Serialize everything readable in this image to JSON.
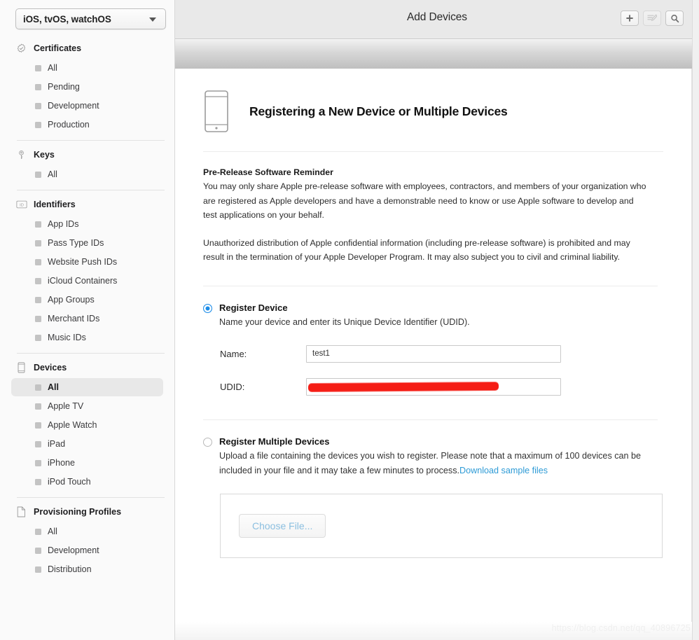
{
  "sidebar": {
    "platform_select": {
      "value": "iOS, tvOS, watchOS",
      "caret_icon": "chevron-down-icon"
    },
    "sections": [
      {
        "title": "Certificates",
        "icon": "certificate-seal-icon",
        "items": [
          {
            "label": "All",
            "selected": false
          },
          {
            "label": "Pending",
            "selected": false
          },
          {
            "label": "Development",
            "selected": false
          },
          {
            "label": "Production",
            "selected": false
          }
        ]
      },
      {
        "title": "Keys",
        "icon": "key-icon",
        "items": [
          {
            "label": "All",
            "selected": false
          }
        ]
      },
      {
        "title": "Identifiers",
        "icon": "id-badge-icon",
        "items": [
          {
            "label": "App IDs",
            "selected": false
          },
          {
            "label": "Pass Type IDs",
            "selected": false
          },
          {
            "label": "Website Push IDs",
            "selected": false
          },
          {
            "label": "iCloud Containers",
            "selected": false
          },
          {
            "label": "App Groups",
            "selected": false
          },
          {
            "label": "Merchant IDs",
            "selected": false
          },
          {
            "label": "Music IDs",
            "selected": false
          }
        ]
      },
      {
        "title": "Devices",
        "icon": "device-phone-icon",
        "items": [
          {
            "label": "All",
            "selected": true
          },
          {
            "label": "Apple TV",
            "selected": false
          },
          {
            "label": "Apple Watch",
            "selected": false
          },
          {
            "label": "iPad",
            "selected": false
          },
          {
            "label": "iPhone",
            "selected": false
          },
          {
            "label": "iPod Touch",
            "selected": false
          }
        ]
      },
      {
        "title": "Provisioning Profiles",
        "icon": "document-icon",
        "items": [
          {
            "label": "All",
            "selected": false
          },
          {
            "label": "Development",
            "selected": false
          },
          {
            "label": "Distribution",
            "selected": false
          }
        ]
      }
    ]
  },
  "header": {
    "title": "Add Devices",
    "actions": [
      {
        "name": "add-button",
        "icon": "plus-icon",
        "enabled": true
      },
      {
        "name": "edit-button",
        "icon": "edit-list-icon",
        "enabled": false
      },
      {
        "name": "search-button",
        "icon": "search-icon",
        "enabled": true
      }
    ]
  },
  "main": {
    "page_icon": "device-phone-outline-icon",
    "page_title": "Registering a New Device or Multiple Devices",
    "notice": {
      "heading": "Pre-Release Software Reminder",
      "paragraph1": "You may only share Apple pre-release software with employees, contractors, and members of your organization who are registered as Apple developers and have a demonstrable need to know or use Apple software to develop and test applications on your behalf.",
      "paragraph2": "Unauthorized distribution of Apple confidential information (including pre-release software) is prohibited and may result in the termination of your Apple Developer Program. It may also subject you to civil and criminal liability."
    },
    "register_device": {
      "selected": true,
      "title": "Register Device",
      "description": "Name your device and enter its Unique Device Identifier (UDID).",
      "name_label": "Name:",
      "name_value": "test1",
      "name_placeholder": "",
      "udid_label": "UDID:",
      "udid_value": "",
      "udid_placeholder": "",
      "udid_redacted": true
    },
    "register_multiple": {
      "selected": false,
      "title": "Register Multiple Devices",
      "description": "Upload a file containing the devices you wish to register. Please note that a maximum of 100 devices can be included in your file and it may take a few minutes to process.",
      "link_label": "Download sample files",
      "choose_file_label": "Choose File..."
    }
  },
  "watermark": "https://blog.csdn.net/qq_40896725",
  "colors": {
    "accent_blue": "#1b8ce8",
    "link_blue": "#2e9bd6",
    "redaction_red": "#f51d15",
    "sidebar_bg": "#fafafa",
    "header_bg": "#e9e9e9",
    "selected_item_bg": "#e8e8e8"
  }
}
